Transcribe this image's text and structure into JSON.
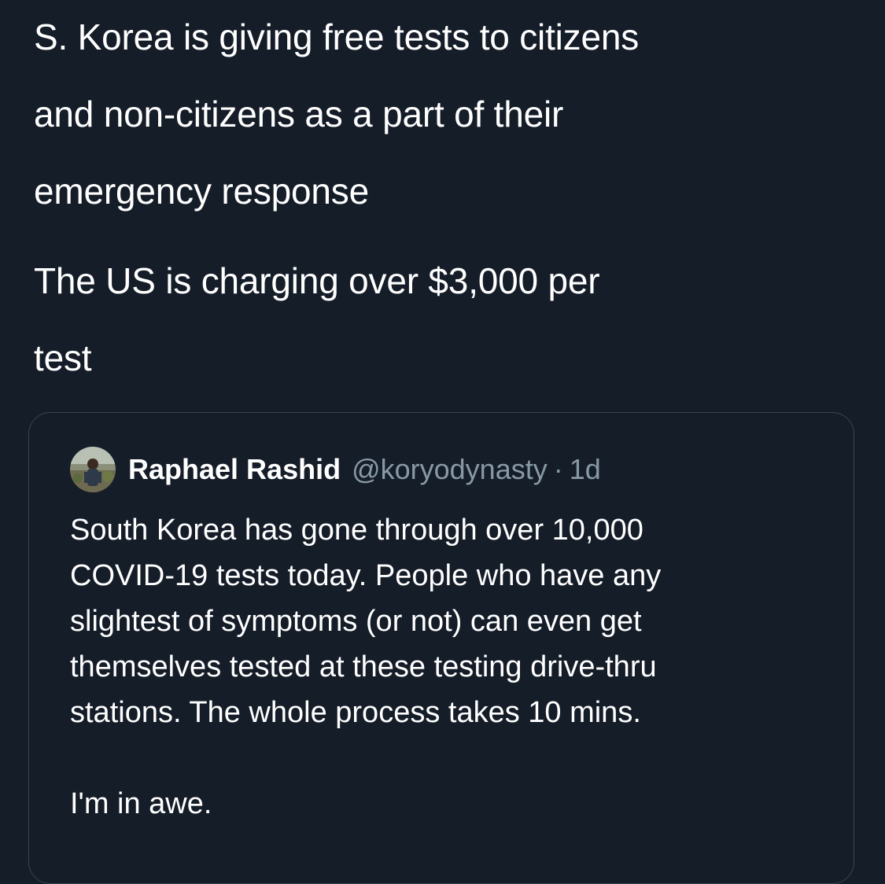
{
  "tweet": {
    "paragraph_1_lines": [
      "S. Korea is giving free tests to citizens",
      "and non-citizens as a part of their",
      "emergency response"
    ],
    "paragraph_2_lines": [
      "The US is charging over $3,000 per",
      "test"
    ]
  },
  "quoted_tweet": {
    "author_name": "Raphael Rashid",
    "author_handle": "@koryodynasty",
    "separator": "·",
    "timestamp": "1d",
    "avatar_icon": "avatar-photo",
    "body_lines": [
      "South Korea has gone through over 10,000",
      "COVID-19 tests today. People who have any",
      "slightest of symptoms (or not) can even get",
      "themselves tested at these testing drive-thru",
      "stations. The whole process takes 10 mins."
    ],
    "closing_line": "I'm in awe."
  },
  "colors": {
    "background": "#151d29",
    "text_primary": "#ffffff",
    "text_secondary": "#8899a6",
    "card_border": "#38444f"
  }
}
